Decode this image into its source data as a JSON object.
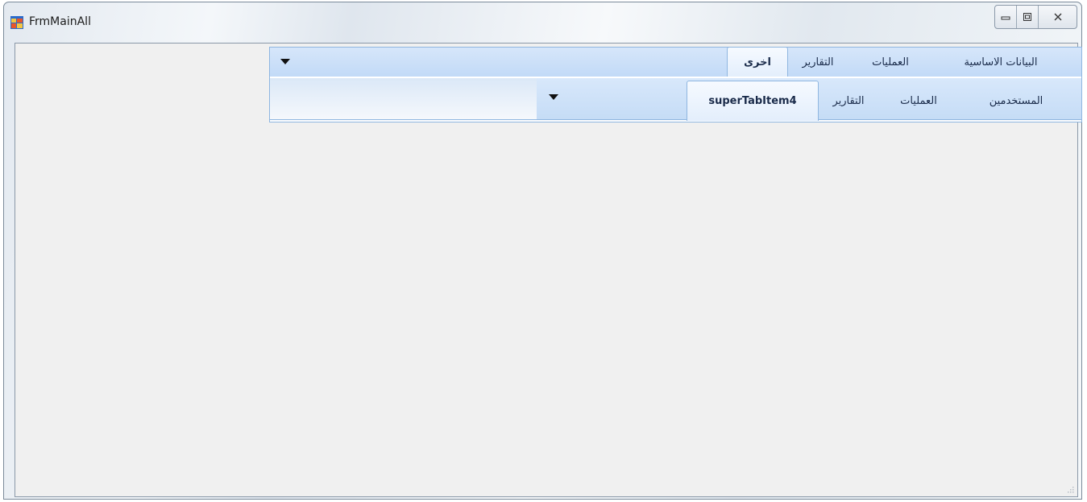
{
  "window": {
    "title": "FrmMainAll",
    "icon": "windows-form-icon",
    "controls": [
      "minimize-icon",
      "maximize-icon",
      "close-icon"
    ]
  },
  "outer_tabs": {
    "items": [
      {
        "label": "البيانات الاساسية",
        "selected": false
      },
      {
        "label": "العمليات",
        "selected": false
      },
      {
        "label": "التقارير",
        "selected": false
      },
      {
        "label": "اخرى",
        "selected": true
      }
    ],
    "menu_icon": "dropdown-arrow-icon"
  },
  "inner_tabs": {
    "items": [
      {
        "label": "المستخدمين",
        "selected": false
      },
      {
        "label": "العمليات",
        "selected": false
      },
      {
        "label": "التقارير",
        "selected": false
      },
      {
        "label": "superTabItem4",
        "selected": true
      }
    ],
    "menu_icon": "dropdown-arrow-icon"
  },
  "colors": {
    "tab_strip": "#c5dcf6",
    "tab_border": "#8fb6e0",
    "client_bg": "#f0f0f0",
    "tab_text": "#1a2b4a"
  }
}
